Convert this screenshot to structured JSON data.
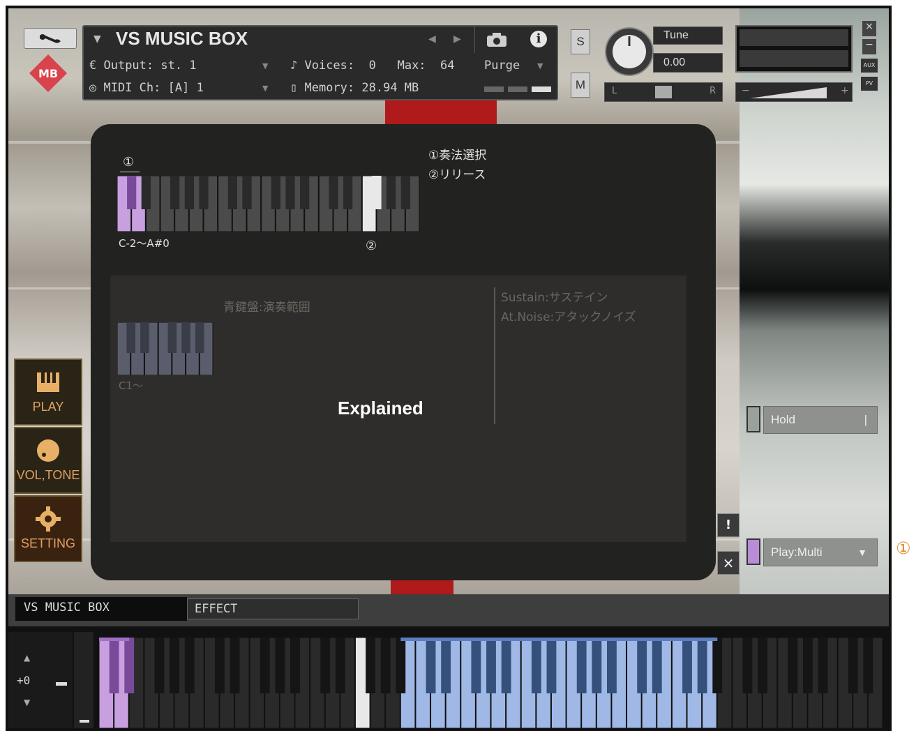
{
  "header": {
    "instrument_name": "VS MUSIC BOX",
    "output_label": "Output:",
    "output_value": "st. 1",
    "midi_label": "MIDI Ch:",
    "midi_value": "[A]  1",
    "voices_label": "Voices:",
    "voices_value": "0",
    "max_label": "Max:",
    "max_value": "64",
    "memory_label": "Memory:",
    "memory_value": "28.94 MB",
    "purge_label": "Purge",
    "solo_label": "S",
    "mute_label": "M",
    "tune_label": "Tune",
    "tune_value": "0.00",
    "pan_left": "L",
    "pan_right": "R",
    "aux_label": "AUX",
    "pv_label": "PV",
    "logo_text": "MB"
  },
  "modal": {
    "legend_line1": "①奏法選択",
    "legend_line2": "②リリース",
    "marker1": "①",
    "marker2": "②",
    "range_label": "C-2～A#0",
    "explained_label": "Explained",
    "inner": {
      "range_desc": "青鍵盤:演奏範囲",
      "range_start": "C1～",
      "sustain_desc": "Sustain:サステイン",
      "noise_desc": "At.Noise:アタックノイズ"
    }
  },
  "side_menu": [
    {
      "label": "PLAY",
      "icon": "piano-icon"
    },
    {
      "label": "VOL,TONE",
      "icon": "knob-icon"
    },
    {
      "label": "SETTING",
      "icon": "gear-icon"
    }
  ],
  "right_controls": {
    "hold_label": "Hold",
    "play_mode": "Play:Multi",
    "alert_label": "!",
    "close_label": "×"
  },
  "bottom_tabs": {
    "tab1": "VS MUSIC BOX",
    "tab2": "EFFECT"
  },
  "keyboard": {
    "octave_value": "+0"
  },
  "annotation": "①",
  "colors": {
    "keyswitch": "#c8a0e0",
    "release": "#e8e8e8",
    "playable": "#9fb8e6",
    "accent_red": "#b01a1a"
  }
}
